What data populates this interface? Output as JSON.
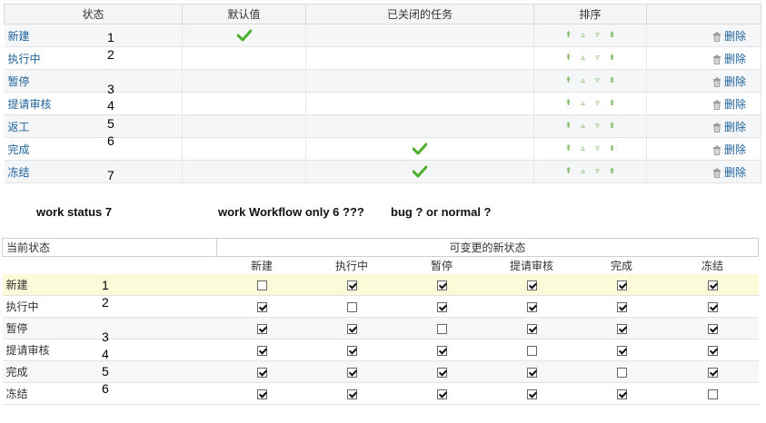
{
  "status_table": {
    "headers": {
      "status": "状态",
      "default": "默认值",
      "closed": "已关闭的任务",
      "sort": "排序",
      "actions": ""
    },
    "delete_label": "删除",
    "rows": [
      {
        "name": "新建",
        "is_default": true,
        "is_closed": false
      },
      {
        "name": "执行中",
        "is_default": false,
        "is_closed": false
      },
      {
        "name": "暂停",
        "is_default": false,
        "is_closed": false
      },
      {
        "name": "提请审核",
        "is_default": false,
        "is_closed": false
      },
      {
        "name": "返工",
        "is_default": false,
        "is_closed": false
      },
      {
        "name": "完成",
        "is_default": false,
        "is_closed": true
      },
      {
        "name": "冻结",
        "is_default": false,
        "is_closed": true
      }
    ],
    "sort_icons": [
      "move-top-icon",
      "move-up-icon",
      "move-down-icon",
      "move-bottom-icon"
    ]
  },
  "overlay_numbers_top": [
    "1",
    "2",
    "3",
    "4",
    "5",
    "6",
    "7"
  ],
  "annotation": {
    "left": "work status 7",
    "right": "work Workflow only 6 ???",
    "question": "bug ? or normal ?"
  },
  "workflow_table": {
    "header_current": "当前状态",
    "header_new": "可变更的新状态",
    "columns": [
      "新建",
      "执行中",
      "暂停",
      "提请审核",
      "完成",
      "冻结"
    ],
    "rows": [
      {
        "name": "新建",
        "checks": [
          false,
          true,
          true,
          true,
          true,
          true
        ]
      },
      {
        "name": "执行中",
        "checks": [
          true,
          false,
          true,
          true,
          true,
          true
        ]
      },
      {
        "name": "暂停",
        "checks": [
          true,
          true,
          false,
          true,
          true,
          true
        ]
      },
      {
        "name": "提请审核",
        "checks": [
          true,
          true,
          true,
          false,
          true,
          true
        ]
      },
      {
        "name": "完成",
        "checks": [
          true,
          true,
          true,
          true,
          false,
          true
        ]
      },
      {
        "name": "冻结",
        "checks": [
          true,
          true,
          true,
          true,
          true,
          false
        ]
      }
    ]
  },
  "overlay_numbers_bottom": [
    "1",
    "2",
    "3",
    "4",
    "5",
    "6"
  ],
  "colors": {
    "link": "#20639b",
    "check_green": "#4caf2a",
    "highlight_row": "#fcfbd9"
  }
}
